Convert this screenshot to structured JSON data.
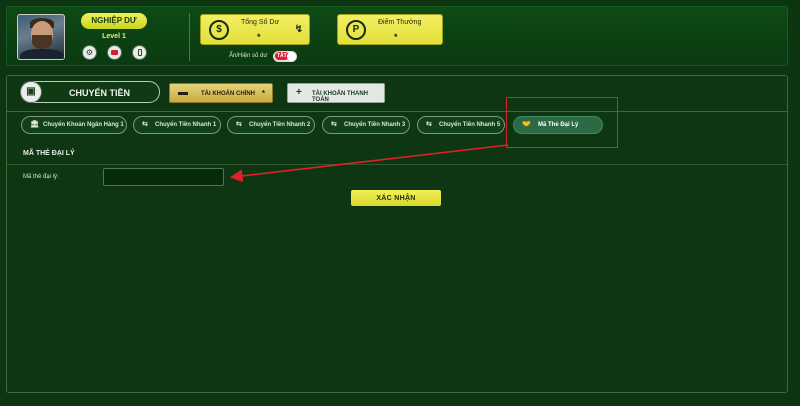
{
  "user": {
    "badge": "NGHIỆP DƯ",
    "level": "Level 1",
    "icons": [
      "user-settings-icon",
      "video-icon",
      "mobile-icon"
    ]
  },
  "stats": {
    "balance": {
      "label": "Tổng Số Dư",
      "value": "*",
      "icon": "coin-stack-icon",
      "refresh_icon": "refresh-icon"
    },
    "points": {
      "label": "Điểm Thưởng",
      "value": "*",
      "icon": "points-icon"
    }
  },
  "balance_toggle": {
    "label": "Ẩn/Hiện số dư",
    "state": "TẮT"
  },
  "transfer": {
    "tab_label": "CHUYỂN TIỀN",
    "icon": "wallet-icon"
  },
  "accounts": {
    "main_label": "TÀI KHOẢN CHÍNH",
    "main_star": "*",
    "payment_label": "TÀI KHOẢN THANH TOÁN"
  },
  "subtabs": [
    {
      "label": "Chuyển Khoản Ngân Hàng 1",
      "icon": "bank-icon"
    },
    {
      "label": "Chuyển Tiền Nhanh 1",
      "icon": "cash-icon"
    },
    {
      "label": "Chuyển Tiền Nhanh 2",
      "icon": "cash-icon"
    },
    {
      "label": "Chuyển Tiền Nhanh 3",
      "icon": "cash-icon"
    },
    {
      "label": "Chuyển Tiền Nhanh 5",
      "icon": "cash-icon"
    },
    {
      "label": "Mã Thẻ Đại Lý",
      "icon": "handshake-icon",
      "active": true
    }
  ],
  "form": {
    "section_title": "MÃ THẺ ĐẠI LÝ",
    "field_label": "Mã thẻ đại lý:",
    "field_value": "",
    "confirm_label": "XÁC NHẬN"
  },
  "colors": {
    "accent": "#e8e63c",
    "background": "#0e3512",
    "highlight_box": "#e0202a"
  }
}
